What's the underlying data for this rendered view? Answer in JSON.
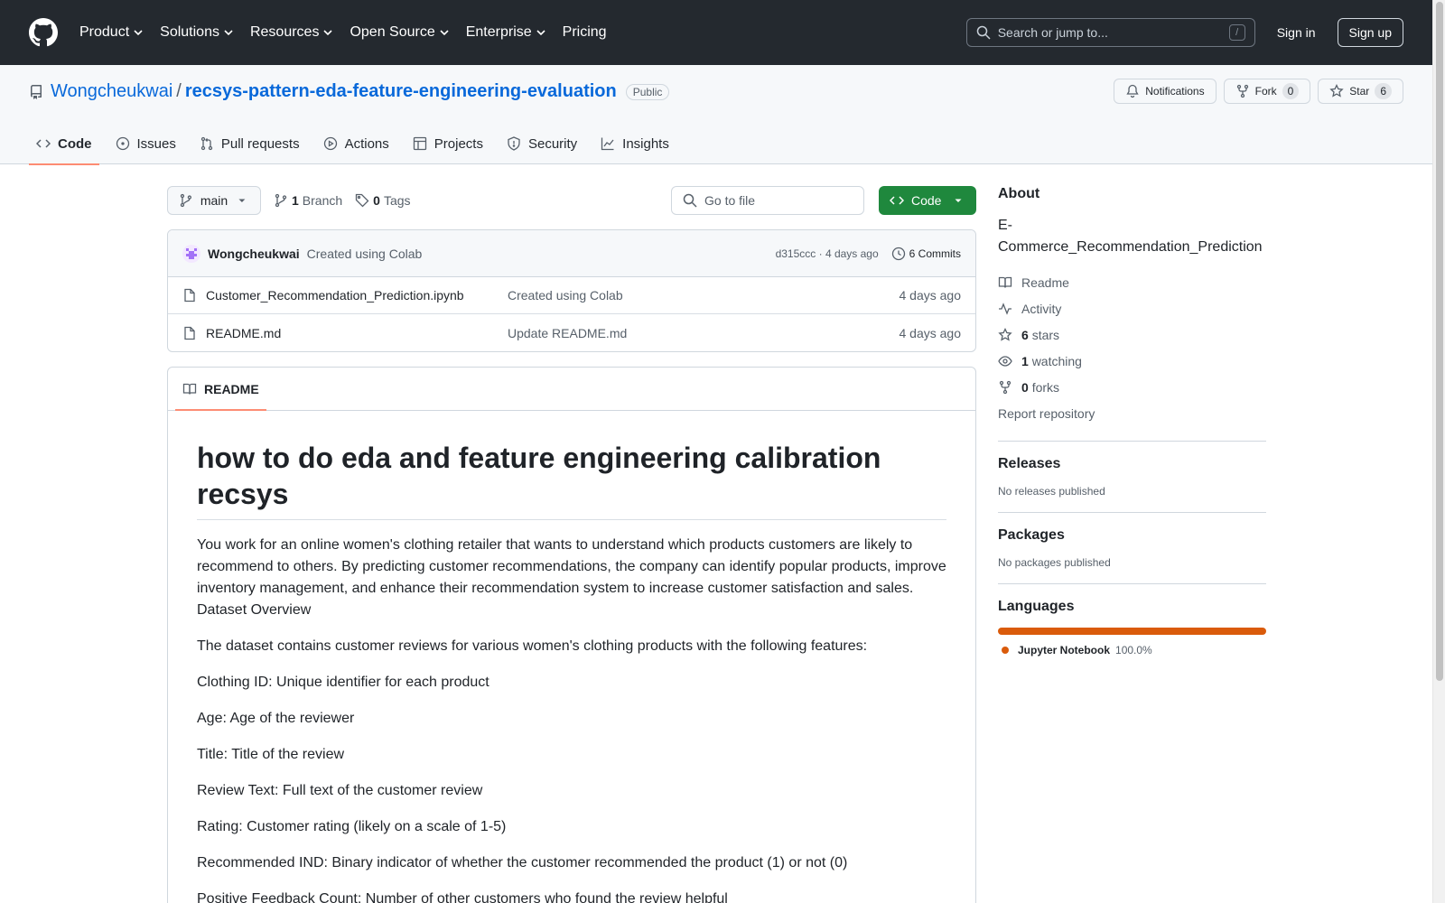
{
  "header": {
    "nav": [
      "Product",
      "Solutions",
      "Resources",
      "Open Source",
      "Enterprise",
      "Pricing"
    ],
    "search_placeholder": "Search or jump to...",
    "search_shortcut": "/",
    "sign_in": "Sign in",
    "sign_up": "Sign up"
  },
  "repo": {
    "owner": "Wongcheukwai",
    "separator": "/",
    "name": "recsys-pattern-eda-feature-engineering-evaluation",
    "visibility": "Public",
    "notifications_label": "Notifications",
    "fork_label": "Fork",
    "fork_count": "0",
    "star_label": "Star",
    "star_count": "6",
    "tabs": [
      "Code",
      "Issues",
      "Pull requests",
      "Actions",
      "Projects",
      "Security",
      "Insights"
    ]
  },
  "file_nav": {
    "branch": "main",
    "branch_count": "1",
    "branch_label": "Branch",
    "tag_count": "0",
    "tag_label": "Tags",
    "goto_placeholder": "Go to file",
    "code_button": "Code"
  },
  "latest_commit": {
    "author": "Wongcheukwai",
    "message": "Created using Colab",
    "hash_age": "d315ccc · 4 days ago",
    "commits_label": "6 Commits"
  },
  "files": [
    {
      "name": "Customer_Recommendation_Prediction.ipynb",
      "commit": "Created using Colab",
      "age": "4 days ago"
    },
    {
      "name": "README.md",
      "commit": "Update README.md",
      "age": "4 days ago"
    }
  ],
  "readme": {
    "tab_label": "README",
    "title": "how to do eda and feature engineering calibration recsys",
    "intro_lines": [
      "You work for an online women's clothing retailer that wants to understand which products customers are likely to",
      "recommend to others. By predicting customer recommendations, the company can identify popular products, improve",
      "inventory management, and enhance their recommendation system to increase customer satisfaction and sales.",
      "Dataset Overview"
    ],
    "paragraphs": [
      "The dataset contains customer reviews for various women's clothing products with the following features:",
      "Clothing ID: Unique identifier for each product",
      "Age: Age of the reviewer",
      "Title: Title of the review",
      "Review Text: Full text of the customer review",
      "Rating: Customer rating (likely on a scale of 1-5)",
      "Recommended IND: Binary indicator of whether the customer recommended the product (1) or not (0)",
      "Positive Feedback Count: Number of other customers who found the review helpful"
    ]
  },
  "about": {
    "heading": "About",
    "description": "E-Commerce_Recommendation_Prediction",
    "readme": "Readme",
    "activity": "Activity",
    "stars_count": "6",
    "stars_label": "stars",
    "watching_count": "1",
    "watching_label": "watching",
    "forks_count": "0",
    "forks_label": "forks",
    "report": "Report repository"
  },
  "releases": {
    "heading": "Releases",
    "text": "No releases published"
  },
  "packages": {
    "heading": "Packages",
    "text": "No packages published"
  },
  "languages": {
    "heading": "Languages",
    "items": [
      {
        "name": "Jupyter Notebook",
        "percent": "100.0%",
        "color": "#da5b0b"
      }
    ]
  }
}
